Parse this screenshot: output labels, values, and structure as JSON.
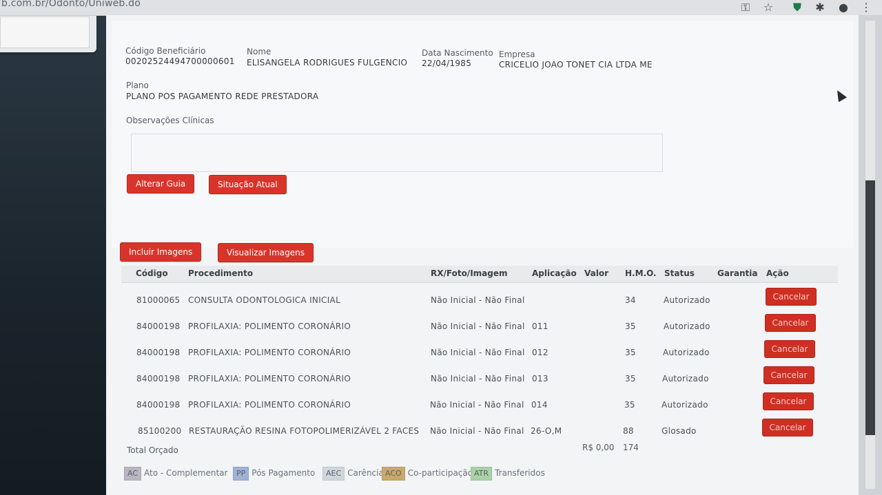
{
  "browser": {
    "url": "b.com.br/Odonto/Uniweb.do",
    "icons": [
      "key-icon",
      "star-icon",
      "shield-icon",
      "puzzle-icon",
      "account-icon",
      "more-icon"
    ]
  },
  "patient": {
    "codigo_label": "Código Beneficiário",
    "codigo_value": "00202524494700000601",
    "nome_label": "Nome",
    "nome_value": "ELISANGELA RODRIGUES FULGENCIO",
    "nascimento_label": "Data Nascimento",
    "nascimento_value": "22/04/1985",
    "empresa_label": "Empresa",
    "empresa_value": "CRICELIO JOAO TONET CIA LTDA ME",
    "plano_label": "Plano",
    "plano_value": "PLANO POS PAGAMENTO REDE PRESTADORA",
    "obs_label": "Observações Clínicas"
  },
  "actions": {
    "alterar_guia": "Alterar Guia",
    "situacao_atual": "Situação Atual",
    "incluir_imagens": "Incluir Imagens",
    "visualizar_imagens": "Visualizar Imagens"
  },
  "table": {
    "headers": {
      "codigo": "Código",
      "procedimento": "Procedimento",
      "rx": "RX/Foto/Imagem",
      "aplicacao": "Aplicação",
      "valor": "Valor",
      "hmo": "H.M.O.",
      "status": "Status",
      "garantia": "Garantia",
      "acao": "Ação"
    },
    "rows": [
      {
        "codigo": "81000065",
        "procedimento": "CONSULTA ODONTOLOGICA INICIAL",
        "rx": "Não Inicial - Não Final",
        "aplicacao": "",
        "valor": "",
        "hmo": "34",
        "status": "Autorizado",
        "garantia": "",
        "acao": "Cancelar"
      },
      {
        "codigo": "84000198",
        "procedimento": "PROFILAXIA: POLIMENTO CORONÁRIO",
        "rx": "Não Inicial - Não Final",
        "aplicacao": "011",
        "valor": "",
        "hmo": "35",
        "status": "Autorizado",
        "garantia": "",
        "acao": "Cancelar"
      },
      {
        "codigo": "84000198",
        "procedimento": "PROFILAXIA: POLIMENTO CORONÁRIO",
        "rx": "Não Inicial - Não Final",
        "aplicacao": "012",
        "valor": "",
        "hmo": "35",
        "status": "Autorizado",
        "garantia": "",
        "acao": "Cancelar"
      },
      {
        "codigo": "84000198",
        "procedimento": "PROFILAXIA: POLIMENTO CORONÁRIO",
        "rx": "Não Inicial - Não Final",
        "aplicacao": "013",
        "valor": "",
        "hmo": "35",
        "status": "Autorizado",
        "garantia": "",
        "acao": "Cancelar"
      },
      {
        "codigo": "84000198",
        "procedimento": "PROFILAXIA: POLIMENTO CORONÁRIO",
        "rx": "Não Inicial - Não Final",
        "aplicacao": "014",
        "valor": "",
        "hmo": "35",
        "status": "Autorizado",
        "garantia": "",
        "acao": "Cancelar"
      },
      {
        "codigo": "85100200",
        "procedimento": "RESTAURAÇÃO RESINA FOTOPOLIMERIZÁVEL 2 FACES",
        "rx": "Não Inicial - Não Final",
        "aplicacao": "26-O,M",
        "valor": "",
        "hmo": "88",
        "status": "Glosado",
        "garantia": "",
        "acao": "Cancelar"
      }
    ],
    "total_label": "Total Orçado",
    "total_valor": "R$ 0,00",
    "total_hmo": "174"
  },
  "legend": [
    {
      "code": "AC",
      "label": "Ato - Complementar",
      "color": "#b9b6c2"
    },
    {
      "code": "PP",
      "label": "Pós Pagamento",
      "color": "#9eb3d6"
    },
    {
      "code": "AEC",
      "label": "Carência",
      "color": "#cfd6de"
    },
    {
      "code": "ACO",
      "label": "Co-participação",
      "color": "#c9a96a"
    },
    {
      "code": "ATR",
      "label": "Transferidos",
      "color": "#a9d3a6"
    }
  ],
  "colors": {
    "accent_button": "#d9342b",
    "page_bg": "#f2f4f6"
  }
}
